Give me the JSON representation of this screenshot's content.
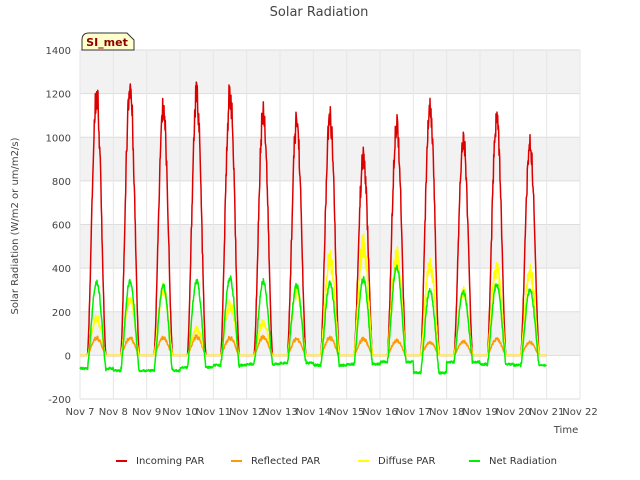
{
  "chart_data": {
    "type": "line",
    "title": "Solar Radiation",
    "xlabel": "Time",
    "ylabel": "Solar Radiation (W/m2 or um/m2/s)",
    "ylim": [
      -200,
      1400
    ],
    "xlim": [
      7,
      22
    ],
    "y_ticks": [
      -200,
      0,
      200,
      400,
      600,
      800,
      1000,
      1200,
      1400
    ],
    "x_ticks": [
      {
        "v": 7,
        "label": "Nov 7"
      },
      {
        "v": 8,
        "label": "Nov 8"
      },
      {
        "v": 9,
        "label": "Nov 9"
      },
      {
        "v": 10,
        "label": "Nov 10"
      },
      {
        "v": 11,
        "label": "Nov 11"
      },
      {
        "v": 12,
        "label": "Nov 12"
      },
      {
        "v": 13,
        "label": "Nov 13"
      },
      {
        "v": 14,
        "label": "Nov 14"
      },
      {
        "v": 15,
        "label": "Nov 15"
      },
      {
        "v": 16,
        "label": "Nov 16"
      },
      {
        "v": 17,
        "label": "Nov 17"
      },
      {
        "v": 18,
        "label": "Nov 18"
      },
      {
        "v": 19,
        "label": "Nov 19"
      },
      {
        "v": 20,
        "label": "Nov 20"
      },
      {
        "v": 21,
        "label": "Nov 21"
      },
      {
        "v": 22,
        "label": "Nov 22"
      }
    ],
    "grid": true,
    "legend_position": "bottom",
    "site_label": "SI_met",
    "day_peaks": [
      {
        "day": 7,
        "incoming": 1190,
        "reflected": 80,
        "diffuse": 170,
        "net": 335,
        "net_night": -60
      },
      {
        "day": 8,
        "incoming": 1230,
        "reflected": 80,
        "diffuse": 260,
        "net": 340,
        "net_night": -70
      },
      {
        "day": 9,
        "incoming": 1130,
        "reflected": 80,
        "diffuse": 300,
        "net": 320,
        "net_night": -70
      },
      {
        "day": 10,
        "incoming": 1195,
        "reflected": 85,
        "diffuse": 120,
        "net": 340,
        "net_night": -55
      },
      {
        "day": 11,
        "incoming": 1200,
        "reflected": 80,
        "diffuse": 230,
        "net": 355,
        "net_night": -45
      },
      {
        "day": 12,
        "incoming": 1120,
        "reflected": 85,
        "diffuse": 150,
        "net": 340,
        "net_night": -40
      },
      {
        "day": 13,
        "incoming": 1075,
        "reflected": 75,
        "diffuse": 300,
        "net": 320,
        "net_night": -35
      },
      {
        "day": 14,
        "incoming": 1090,
        "reflected": 80,
        "diffuse": 440,
        "net": 330,
        "net_night": -45
      },
      {
        "day": 15,
        "incoming": 905,
        "reflected": 75,
        "diffuse": 500,
        "net": 350,
        "net_night": -40
      },
      {
        "day": 16,
        "incoming": 1070,
        "reflected": 70,
        "diffuse": 470,
        "net": 410,
        "net_night": -30
      },
      {
        "day": 17,
        "incoming": 1145,
        "reflected": 60,
        "diffuse": 420,
        "net": 300,
        "net_night": -80
      },
      {
        "day": 18,
        "incoming": 1000,
        "reflected": 65,
        "diffuse": 300,
        "net": 295,
        "net_night": -30
      },
      {
        "day": 19,
        "incoming": 1085,
        "reflected": 75,
        "diffuse": 400,
        "net": 325,
        "net_night": -40
      },
      {
        "day": 20,
        "incoming": 965,
        "reflected": 60,
        "diffuse": 380,
        "net": 300,
        "net_night": -45
      }
    ],
    "series": [
      {
        "name": "Incoming PAR",
        "color": "#dd0000"
      },
      {
        "name": "Reflected PAR",
        "color": "#ff9900"
      },
      {
        "name": "Diffuse PAR",
        "color": "#ffff00"
      },
      {
        "name": "Net Radiation",
        "color": "#00ee00"
      }
    ]
  }
}
